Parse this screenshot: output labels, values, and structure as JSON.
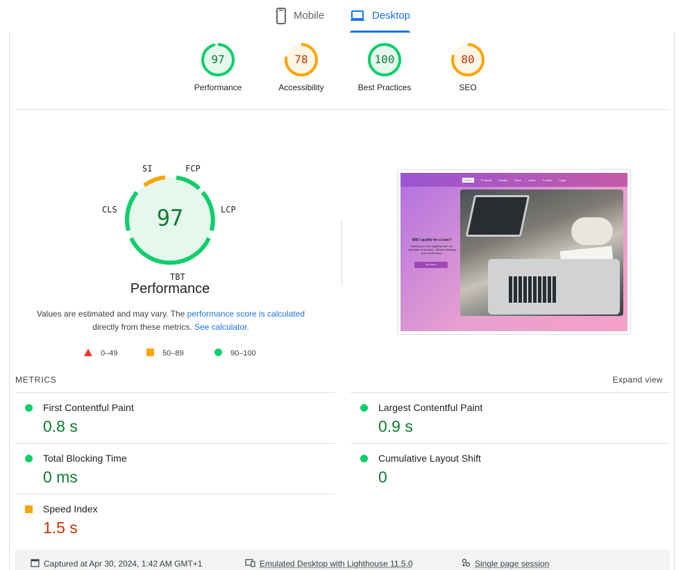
{
  "tabs": {
    "mobile": {
      "label": "Mobile",
      "icon": "phone-icon"
    },
    "desktop": {
      "label": "Desktop",
      "icon": "laptop-icon",
      "active": true
    }
  },
  "scores": [
    {
      "label": "Performance",
      "score": "97",
      "status": "good"
    },
    {
      "label": "Accessibility",
      "score": "78",
      "status": "average"
    },
    {
      "label": "Best Practices",
      "score": "100",
      "status": "good"
    },
    {
      "label": "SEO",
      "score": "80",
      "status": "average"
    }
  ],
  "performance": {
    "score": "97",
    "title": "Performance",
    "arc_labels": {
      "si": "SI",
      "fcp": "FCP",
      "lcp": "LCP",
      "tbt": "TBT",
      "cls": "CLS"
    },
    "desc_prefix": "Values are estimated and may vary. The ",
    "desc_link1": "performance score is calculated",
    "desc_mid": "directly from these metrics.",
    "desc_link2": "See calculator.",
    "legend": [
      {
        "range": "0–49",
        "shape": "triangle",
        "color": "#ff3333"
      },
      {
        "range": "50–89",
        "shape": "square",
        "color": "#ffa400"
      },
      {
        "range": "90–100",
        "shape": "circle",
        "color": "#0cce6b"
      }
    ]
  },
  "preview": {
    "nav": [
      "Home",
      "Products",
      "Guides",
      "News",
      "About",
      "Contact",
      "Login"
    ],
    "heading": "Will I qualify for a loan?",
    "body": "Check your loan eligibility with our calculator in minutes - without affecting your credit score",
    "button": "Get started"
  },
  "metrics": {
    "header": "METRICS",
    "expand": "Expand view",
    "items": [
      {
        "name": "First Contentful Paint",
        "value": "0.8 s",
        "status": "good"
      },
      {
        "name": "Largest Contentful Paint",
        "value": "0.9 s",
        "status": "good"
      },
      {
        "name": "Total Blocking Time",
        "value": "0 ms",
        "status": "good"
      },
      {
        "name": "Cumulative Layout Shift",
        "value": "0",
        "status": "good"
      },
      {
        "name": "Speed Index",
        "value": "1.5 s",
        "status": "average"
      }
    ]
  },
  "footer": {
    "captured": "Captured at Apr 30, 2024, 1:42 AM GMT+1",
    "emulated": "Emulated Desktop with Lighthouse 11.5.0",
    "session": "Single page session"
  },
  "colors": {
    "good": "#0cce6b",
    "good_text": "#0c7c32",
    "average": "#ffa400",
    "average_text": "#c33300",
    "accent": "#1a73e8"
  }
}
